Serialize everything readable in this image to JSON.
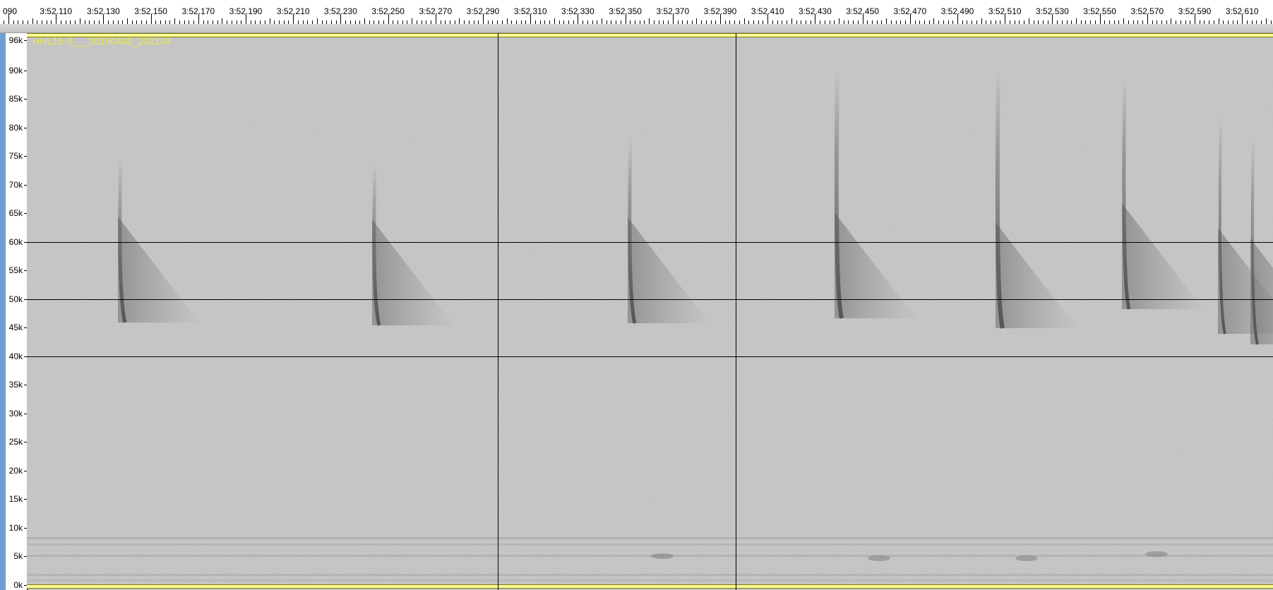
{
  "ruler": {
    "labels": [
      "090",
      "3:52.110",
      "3:52.130",
      "3:52.150",
      "3:52.170",
      "3:52.190",
      "3:52.210",
      "3:52.230",
      "3:52.250",
      "3:52.270",
      "3:52.290",
      "3:52.310",
      "3:52.330",
      "3:52.350",
      "3:52.370",
      "3:52.390",
      "3:52.410",
      "3:52.430",
      "3:52.450",
      "3:52.470",
      "3:52.490",
      "3:52.510",
      "3:52.530",
      "3:52.550",
      "3:52.570",
      "3:52.590",
      "3:52.610"
    ]
  },
  "track": {
    "name": "HHL15-3___20150402_202143",
    "freq_labels": [
      "96k",
      "90k",
      "85k",
      "80k",
      "75k",
      "70k",
      "65k",
      "60k",
      "55k",
      "50k",
      "45k",
      "40k",
      "35k",
      "30k",
      "25k",
      "20k",
      "15k",
      "10k",
      "5k",
      "0k"
    ],
    "name_color": "#e8e84a",
    "accent_color": "#6f9fd0",
    "spectrogram_bg": "#c8c8c8"
  }
}
